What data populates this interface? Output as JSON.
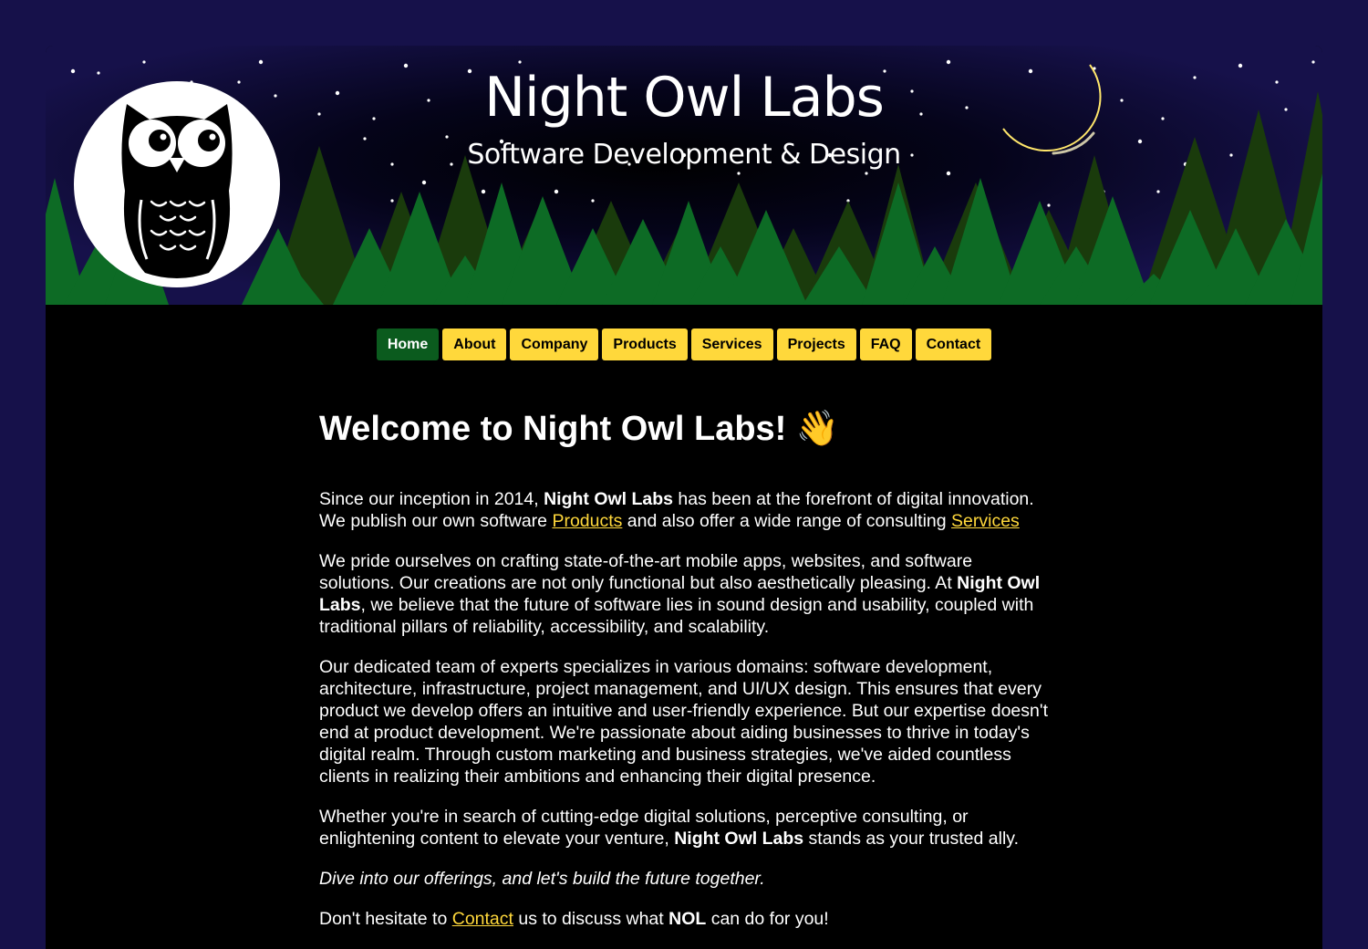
{
  "header": {
    "title": "Night Owl Labs",
    "subtitle": "Software Development & Design"
  },
  "nav": {
    "items": [
      {
        "label": "Home",
        "active": true
      },
      {
        "label": "About"
      },
      {
        "label": "Company"
      },
      {
        "label": "Products"
      },
      {
        "label": "Services"
      },
      {
        "label": "Projects"
      },
      {
        "label": "FAQ"
      },
      {
        "label": "Contact"
      }
    ]
  },
  "main": {
    "heading": "Welcome to Night Owl Labs!",
    "heading_emoji": "👋",
    "p1": {
      "t1": "Since our inception in 2014, ",
      "b1": "Night Owl Labs",
      "t2": " has been at the forefront of digital innovation. We publish our own software ",
      "link1": "Products",
      "t3": " and also offer a wide range of consulting ",
      "link2": "Services"
    },
    "p2": {
      "t1": "We pride ourselves on crafting state-of-the-art mobile apps, websites, and software solutions. Our creations are not only functional but also aesthetically pleasing. At ",
      "b1": "Night Owl Labs",
      "t2": ", we believe that the future of software lies in sound design and usability, coupled with traditional pillars of reliability, accessibility, and scalability."
    },
    "p3": "Our dedicated team of experts specializes in various domains: software development, architecture, infrastructure, project management, and UI/UX design. This ensures that every product we develop offers an intuitive and user-friendly experience. But our expertise doesn't end at product development. We're passionate about aiding businesses to thrive in today's digital realm. Through custom marketing and business strategies, we've aided countless clients in realizing their ambitions and enhancing their digital presence.",
    "p4": {
      "t1": "Whether you're in search of cutting-edge digital solutions, perceptive consulting, or enlightening content to elevate your venture, ",
      "b1": "Night Owl Labs",
      "t2": " stands as your trusted ally."
    },
    "p5": "Dive into our offerings, and let's build the future together.",
    "p6": {
      "t1": "Don't hesitate to ",
      "link1": "Contact",
      "t2": " us to discuss what ",
      "b1": "NOL",
      "t3": " can do for you!"
    }
  },
  "colors": {
    "page_bg": "#16114a",
    "accent": "#ffd83b",
    "active_nav": "#0b5b1e",
    "tree_light": "#0d6b25",
    "tree_dark": "#1a3b0c"
  },
  "icons": [
    "owl-logo-icon",
    "moon-icon",
    "waving-hand-icon"
  ]
}
